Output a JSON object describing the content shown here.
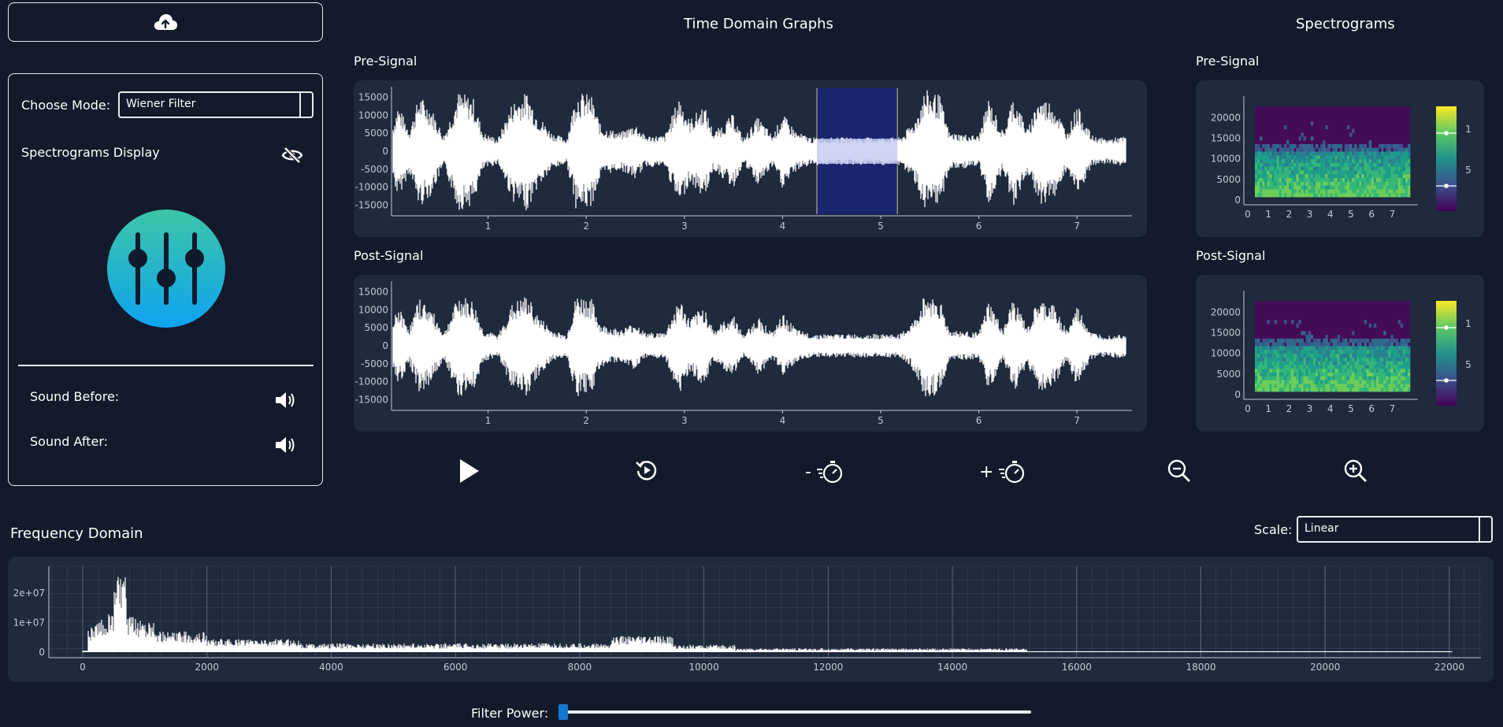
{
  "upload": {
    "icon": "cloud-upload-icon"
  },
  "controls": {
    "mode_label": "Choose Mode:",
    "mode_value": "Wiener Filter",
    "spectrogram_label": "Spectrograms Display",
    "sound_before_label": "Sound Before:",
    "sound_after_label": "Sound After:",
    "logo_icon": "equalizer-sliders-icon"
  },
  "time_domain": {
    "title": "Time Domain Graphs",
    "pre_label": "Pre-Signal",
    "post_label": "Post-Signal",
    "y_ticks": [
      "15000",
      "10000",
      "5000",
      "0",
      "-5000",
      "-10000",
      "-15000"
    ],
    "x_ticks": [
      "1",
      "2",
      "3",
      "4",
      "5",
      "6",
      "7"
    ],
    "selection_region": [
      4.35,
      5.17
    ]
  },
  "spectrograms": {
    "title": "Spectrograms",
    "pre_label": "Pre-Signal",
    "post_label": "Post-Signal",
    "y_ticks": [
      "20000",
      "15000",
      "10000",
      "5000",
      "0"
    ],
    "x_ticks": [
      "0",
      "1",
      "2",
      "3",
      "4",
      "5",
      "6",
      "7"
    ],
    "colorbar_ticks": [
      "1",
      "5"
    ]
  },
  "playback": {
    "play": "play-icon",
    "replay": "replay-icon",
    "slow_down_label": "-",
    "speed_up_label": "+",
    "zoom_out": "zoom-out-icon",
    "zoom_in": "zoom-in-icon"
  },
  "frequency_domain": {
    "title": "Frequency Domain",
    "scale_label": "Scale:",
    "scale_value": "Linear",
    "y_ticks": [
      "2e+07",
      "1e+07",
      "0"
    ],
    "x_ticks": [
      "0",
      "2000",
      "4000",
      "6000",
      "8000",
      "10000",
      "12000",
      "14000",
      "16000",
      "18000",
      "20000",
      "22000"
    ]
  },
  "filter": {
    "label": "Filter Power:",
    "value": 0.0
  },
  "colors": {
    "background": "#121a2b",
    "card": "#1f2a3c",
    "selection": "#1a2570",
    "accent": "#1677d2",
    "logo_top": "#3cc6a6",
    "logo_bottom": "#0ea3f0"
  }
}
